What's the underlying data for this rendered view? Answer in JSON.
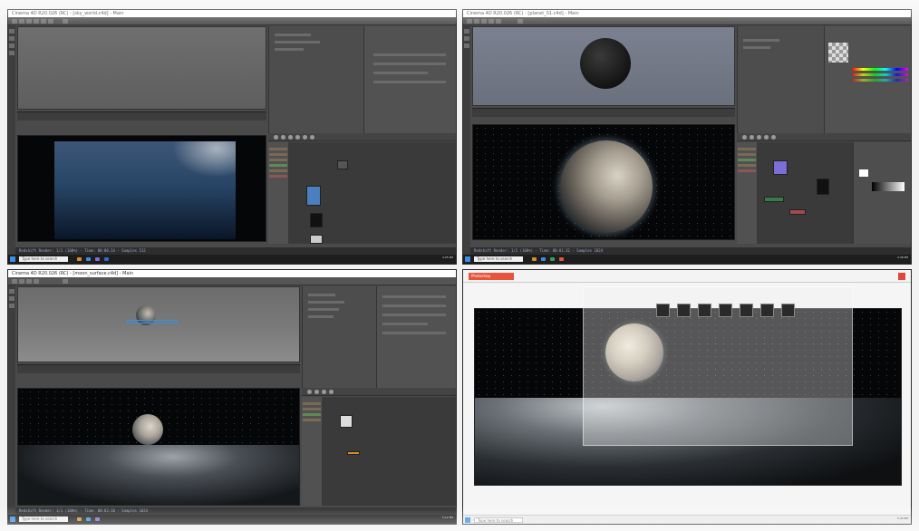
{
  "panels": [
    {
      "window_title": "Cinema 4D R20.026 (RC) - [sky_world.c4d] - Main",
      "status_text": "Redshift Render: 1/1 (100%) - Time: 00:00:14 - Samples 512",
      "taskbar_search": "Type here to search",
      "clock": "4:25 PM"
    },
    {
      "window_title": "Cinema 4D R20.026 (RC) - [planet_01.c4d] - Main",
      "status_text": "Redshift Render: 1/1 (100%) - Time: 00:01:32 - Samples 1024",
      "taskbar_search": "Type here to search",
      "clock": "4:48 PM"
    },
    {
      "window_title": "Cinema 4D R20.026 (RC) - [moon_surface.c4d] - Main",
      "status_text": "Redshift Render: 1/1 (100%) - Time: 00:02:10 - Samples 1024",
      "taskbar_search": "Type here to search",
      "clock": "5:12 PM"
    },
    {
      "window_title": "Photoshop",
      "taskbar_search": "Type here to search",
      "browser_tab": "Photoshop",
      "clock": "5:40 PM"
    }
  ],
  "colors": {
    "app_bg": "#4a4a4a",
    "taskbar": "#1d1d1d",
    "accent_orange": "#e8533b",
    "node_orange": "#d98c2b",
    "node_blue": "#4a7fc0",
    "node_purple": "#7b6fd6"
  }
}
